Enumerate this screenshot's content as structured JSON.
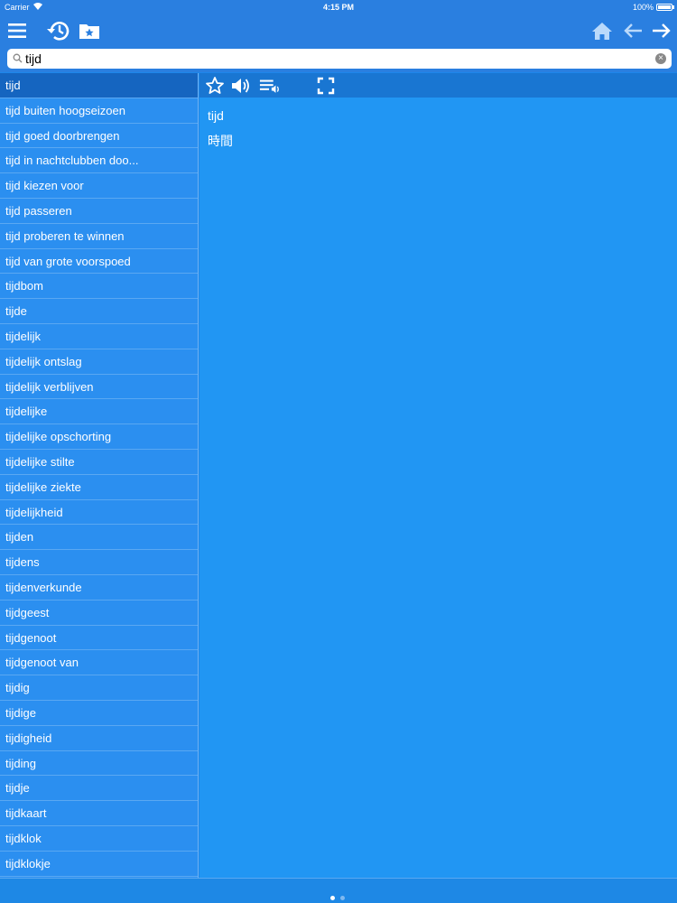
{
  "status": {
    "carrier": "Carrier",
    "time": "4:15 PM",
    "battery": "100%"
  },
  "search": {
    "value": "tijd",
    "placeholder": ""
  },
  "list": {
    "items": [
      "tijd",
      "tijd buiten hoogseizoen",
      "tijd goed doorbrengen",
      "tijd in nachtclubben doo...",
      "tijd kiezen voor",
      "tijd passeren",
      "tijd proberen te winnen",
      "tijd van grote voorspoed",
      "tijdbom",
      "tijde",
      "tijdelijk",
      "tijdelijk ontslag",
      "tijdelijk verblijven",
      "tijdelijke",
      "tijdelijke opschorting",
      "tijdelijke stilte",
      "tijdelijke ziekte",
      "tijdelijkheid",
      "tijden",
      "tijdens",
      "tijdenverkunde",
      "tijdgeest",
      "tijdgenoot",
      "tijdgenoot van",
      "tijdig",
      "tijdige",
      "tijdigheid",
      "tijding",
      "tijdje",
      "tijdkaart",
      "tijdklok",
      "tijdklokje"
    ],
    "selected_index": 0
  },
  "entry": {
    "term": "tijd",
    "translation": "時間"
  },
  "icons": {
    "nav_left": [
      "menu-icon",
      "history-icon",
      "favorites-folder-icon"
    ],
    "nav_right": [
      "home-icon",
      "back-arrow-icon",
      "forward-arrow-icon"
    ],
    "toolbar": [
      "star-icon",
      "speaker-icon",
      "playlist-audio-icon",
      "fullscreen-icon"
    ]
  },
  "colors": {
    "nav": "#2a7fe0",
    "list": "#2b8ff0",
    "selected": "#1565c0",
    "detail": "#2196f3",
    "toolbar": "#1976d2"
  },
  "pager": {
    "pages": 2,
    "current": 0
  }
}
